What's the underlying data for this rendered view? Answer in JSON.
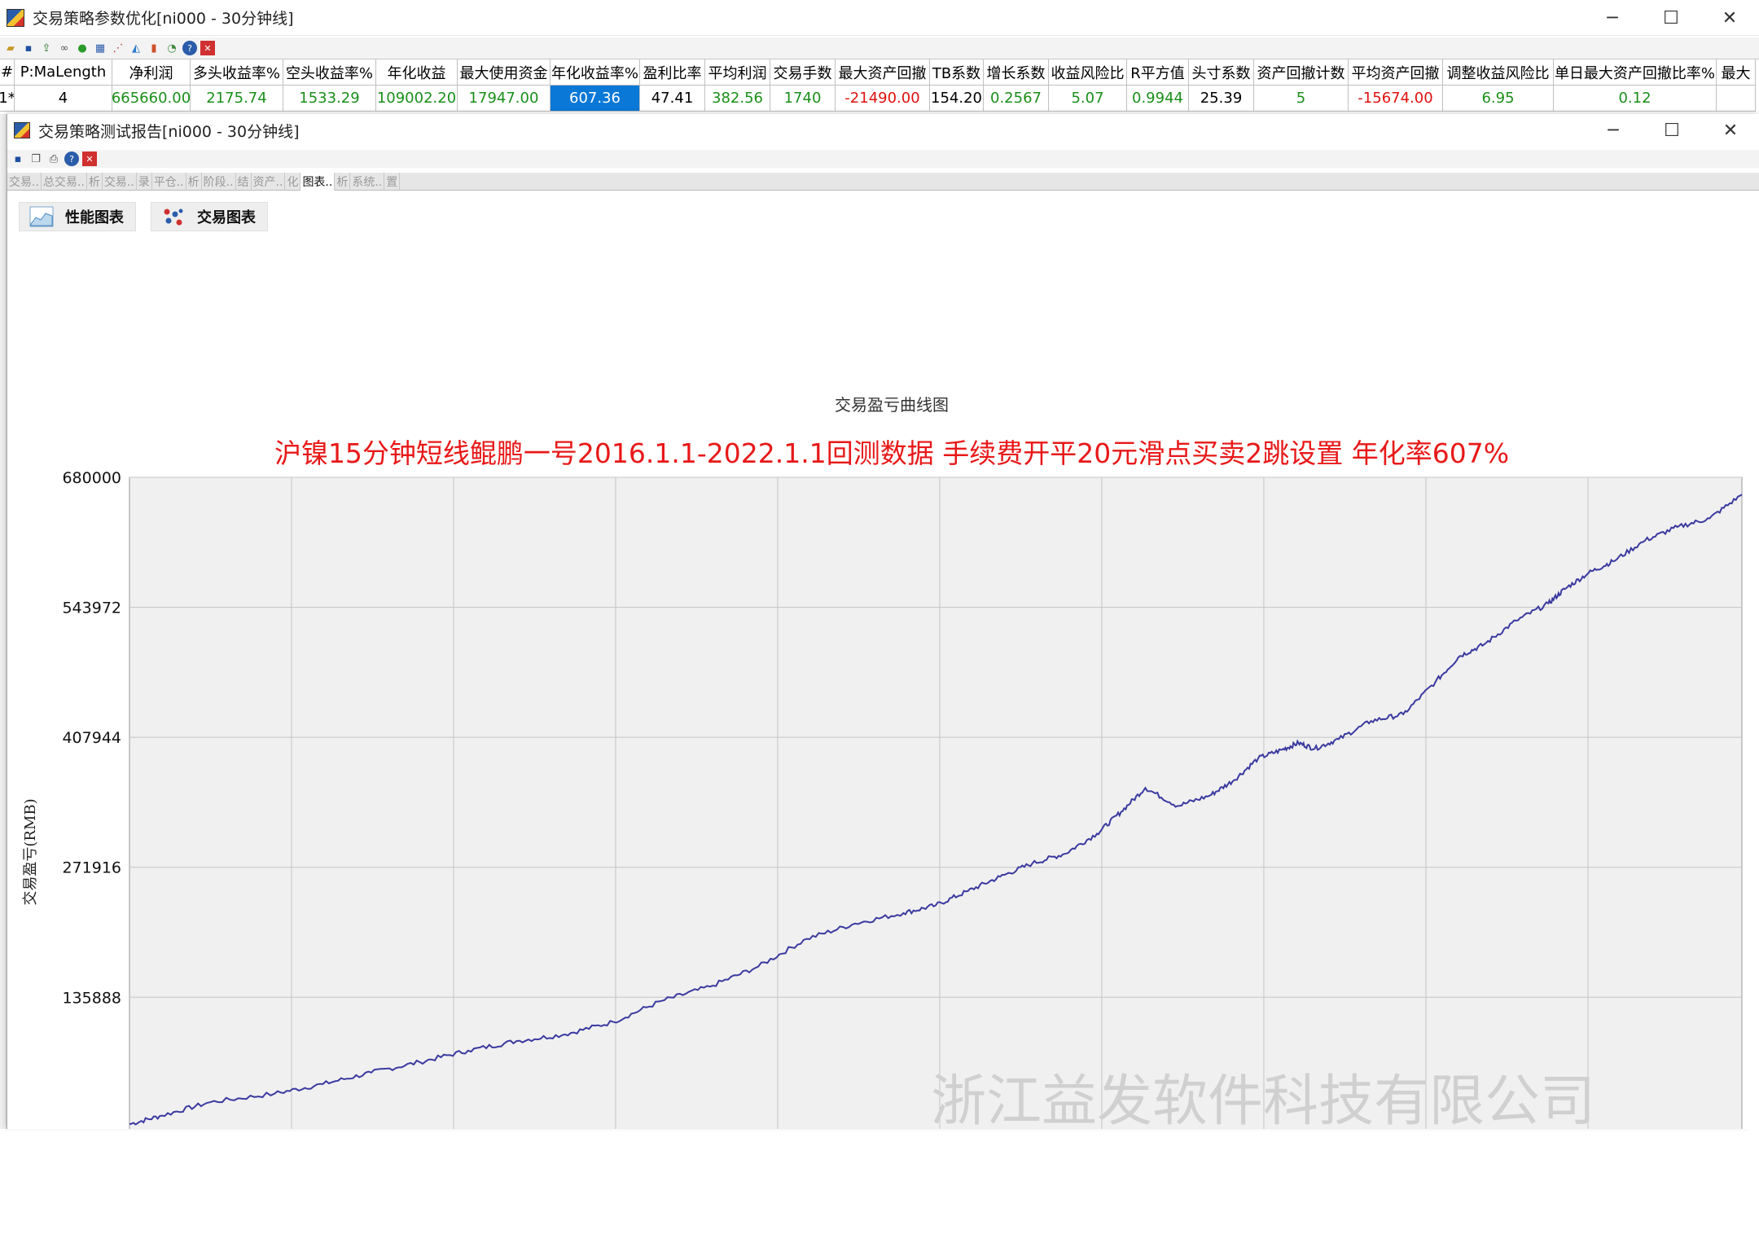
{
  "outer_window": {
    "title": "交易策略参数优化[ni000 - 30分钟线]",
    "controls": {
      "minimize": "─",
      "maximize": "☐",
      "close": "✕"
    }
  },
  "results_grid": {
    "headers": [
      "#",
      "P:MaLength",
      "净利润",
      "多头收益率%",
      "空头收益率%",
      "年化收益",
      "最大使用资金",
      "年化收益率%",
      "盈利比率",
      "平均利润",
      "交易手数",
      "最大资产回撤",
      "TB系数",
      "增长系数",
      "收益风险比",
      "R平方值",
      "头寸系数",
      "资产回撤计数",
      "平均资产回撤",
      "调整收益风险比",
      "单日最大资产回撤比率%",
      "最大"
    ],
    "row": [
      "1*",
      "4",
      "665660.00",
      "2175.74",
      "1533.29",
      "109002.20",
      "17947.00",
      "607.36",
      "47.41",
      "382.56",
      "1740",
      "-21490.00",
      "154.20",
      "0.2567",
      "5.07",
      "0.9944",
      "25.39",
      "5",
      "-15674.00",
      "6.95",
      "0.12",
      ""
    ]
  },
  "report_window": {
    "title": "交易策略测试报告[ni000 - 30分钟线]",
    "controls": {
      "minimize": "─",
      "maximize": "☐",
      "close": "✕"
    },
    "tabs": [
      "交易..",
      "总交易..",
      "析",
      "交易..",
      "录",
      "平仓..",
      "析",
      "阶段..",
      "结",
      "资产..",
      "化",
      "图表..",
      "析",
      "系统..",
      "置"
    ],
    "active_tab": "图表..",
    "chart_buttons": {
      "performance": "性能图表",
      "trades": "交易图表"
    }
  },
  "watermark": "浙江益发软件科技有限公司",
  "chart_data": {
    "type": "line",
    "title": "交易盈亏曲线图",
    "subtitle": "沪镍15分钟短线鲲鹏一号2016.1.1-2022.1.1回测数据  手续费开平20元滑点买卖2跳设置  年化率607%",
    "ylabel": "交易盈亏(RMB)",
    "xlabel": "",
    "yticks": [
      680000,
      543972,
      407944,
      271916,
      135888
    ],
    "ylim": [
      -2000,
      680000
    ],
    "grid": true,
    "x": [
      0,
      2,
      5,
      9,
      12,
      15,
      18,
      21,
      24,
      27,
      30,
      33,
      36,
      39,
      42,
      45,
      48,
      50,
      52,
      54,
      56,
      58,
      60,
      61.5,
      63,
      65,
      67,
      68.5,
      70,
      71.5,
      72.5,
      73.5,
      75,
      77,
      79,
      81,
      82.5,
      84,
      86,
      88,
      89,
      90.5,
      92,
      94,
      96,
      98,
      100
    ],
    "y": [
      3000,
      12000,
      26000,
      35000,
      45000,
      57000,
      68000,
      80000,
      90000,
      97000,
      110000,
      132000,
      147000,
      168000,
      197000,
      213000,
      224000,
      232000,
      247000,
      262000,
      276000,
      286000,
      307000,
      330000,
      355000,
      336000,
      347000,
      363000,
      386000,
      395000,
      402000,
      396000,
      406000,
      425000,
      432000,
      466000,
      493000,
      505000,
      530000,
      548000,
      563000,
      580000,
      592000,
      614000,
      628000,
      637000,
      662000
    ]
  }
}
